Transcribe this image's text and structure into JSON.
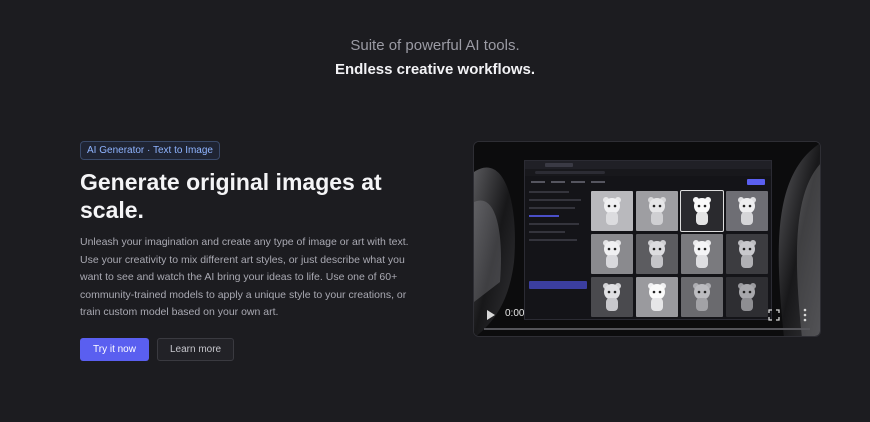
{
  "hero": {
    "line1": "Suite of powerful AI tools.",
    "line2": "Endless creative workflows."
  },
  "feature": {
    "tag": "AI Generator · Text to Image",
    "heading": "Generate original images at scale.",
    "description": "Unleash your imagination and create any type of image or art with text. Use your creativity to mix different art styles, or just describe what you want to see and watch the AI bring your ideas to life. Use one of 60+ community-trained models to apply a unique style to your creations, or train custom model based on your own art.",
    "primary_button": "Try it now",
    "secondary_button": "Learn more"
  },
  "video": {
    "time": "0:00",
    "icons": [
      "play-icon",
      "fullscreen-icon",
      "more-vertical-icon"
    ]
  },
  "colors": {
    "background": "#1c1c20",
    "accent": "#5a5ff0"
  }
}
